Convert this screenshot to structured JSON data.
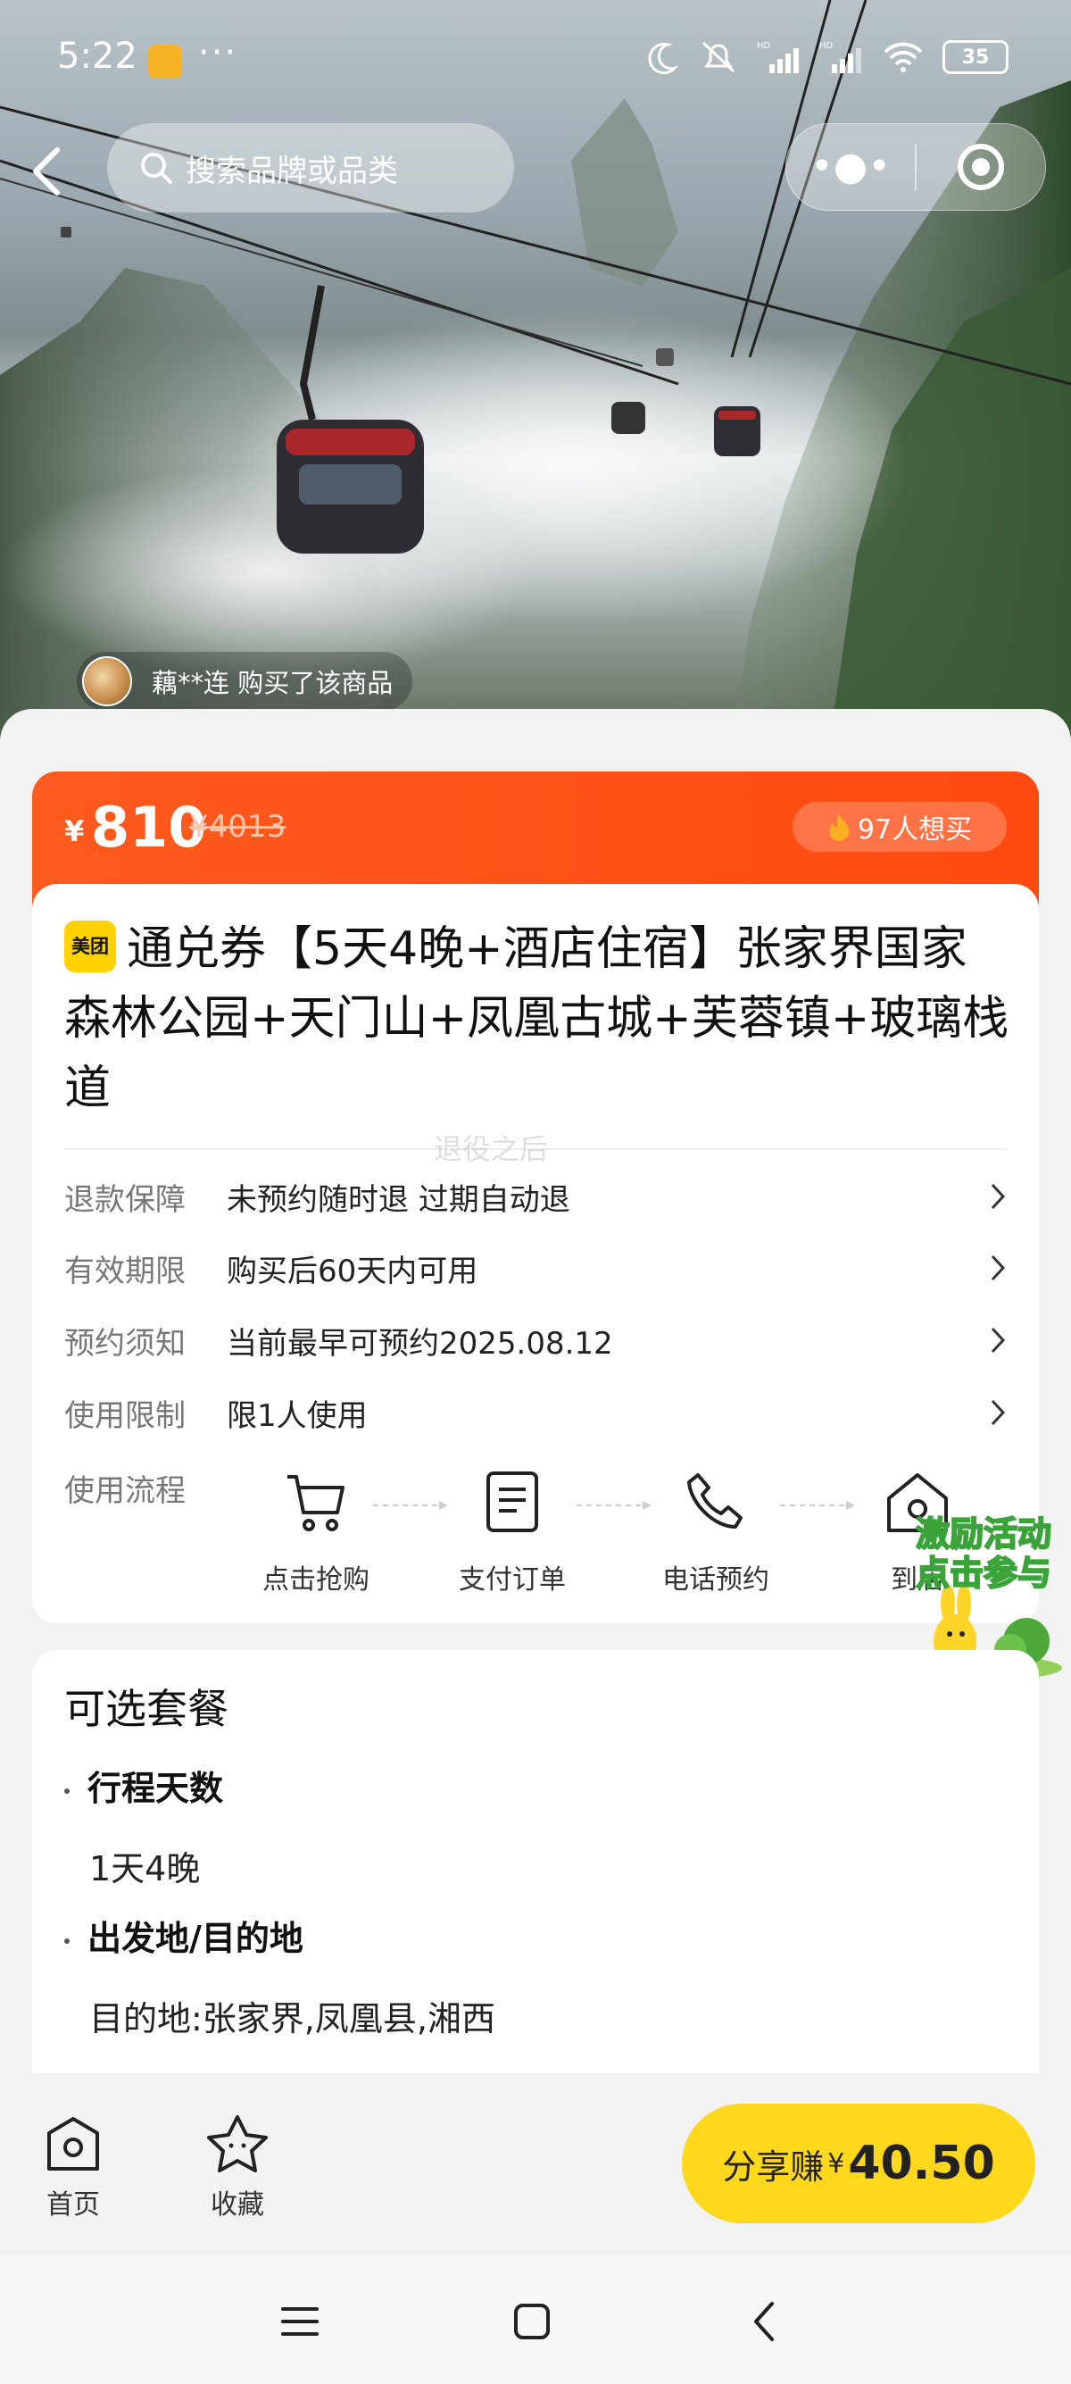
{
  "status_bar": {
    "time": "5:22",
    "more": "···",
    "battery": "35"
  },
  "header": {
    "search_placeholder": "搜索品牌或品类",
    "capsule_more": "•●•"
  },
  "hero": {
    "buyer_note": "藕**连 购买了该商品"
  },
  "price": {
    "currency": "¥",
    "current": "810",
    "original": "¥4013",
    "want_count": "97人想买"
  },
  "product": {
    "brand_badge": "美团",
    "title": "通兑券【5天4晚+酒店住宿】张家界国家森林公园+天门山+凤凰古城+芙蓉镇+玻璃栈道"
  },
  "watermark": "退役之后",
  "details": [
    {
      "label": "退款保障",
      "value": "未预约随时退 过期自动退"
    },
    {
      "label": "有效期限",
      "value": "购买后60天内可用"
    },
    {
      "label": "预约须知",
      "value": "当前最早可预约2025.08.12"
    },
    {
      "label": "使用限制",
      "value": "限1人使用"
    }
  ],
  "flow": {
    "label": "使用流程",
    "steps": [
      {
        "label": "点击抢购",
        "icon": "cart-icon"
      },
      {
        "label": "支付订单",
        "icon": "document-icon"
      },
      {
        "label": "电话预约",
        "icon": "phone-icon"
      },
      {
        "label": "到店",
        "icon": "store-icon"
      }
    ]
  },
  "promo": {
    "line1": "激励活动",
    "line2": "点击参与"
  },
  "package": {
    "title": "可选套餐",
    "sections": [
      {
        "heading": "行程天数",
        "value": "1天4晚"
      },
      {
        "heading": "出发地/目的地",
        "value": "目的地:张家界,凤凰县,湘西"
      }
    ]
  },
  "bottom_bar": {
    "home_label": "首页",
    "favorite_label": "收藏",
    "share_label": "分享赚",
    "share_currency": "¥",
    "share_amount": "40.50"
  },
  "colors": {
    "accent_orange": "#ff5a1f",
    "share_yellow": "#ffd81e",
    "brand_yellow": "#ffd100"
  }
}
